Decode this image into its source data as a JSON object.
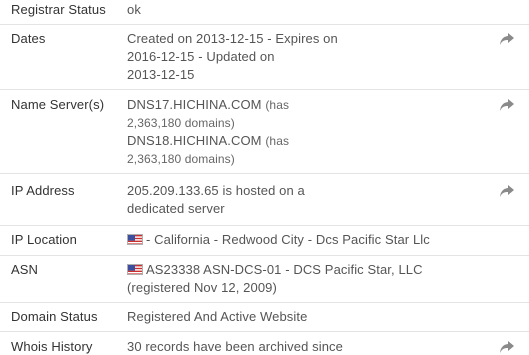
{
  "rows": {
    "registrar_status": {
      "label": "Registrar Status",
      "value": "ok"
    },
    "dates": {
      "label": "Dates",
      "lines": [
        "Created on 2013-12-15 - Expires on",
        "2016-12-15 - Updated on",
        "2013-12-15"
      ]
    },
    "name_servers": {
      "label": "Name Server(s)",
      "ns1": {
        "host": "DNS17.HICHINA.COM",
        "note1": "(has",
        "note2": "2,363,180 domains)"
      },
      "ns2": {
        "host": "DNS18.HICHINA.COM",
        "note1": "(has",
        "note2": "2,363,180 domains)"
      }
    },
    "ip_address": {
      "label": "IP Address",
      "lines": [
        "205.209.133.65 is hosted on a",
        "dedicated server"
      ]
    },
    "ip_location": {
      "label": "IP Location",
      "value": "- California - Redwood City - Dcs Pacific Star Llc"
    },
    "asn": {
      "label": "ASN",
      "line1": "AS23338 ASN-DCS-01 - DCS Pacific Star, LLC",
      "line2": "(registered Nov 12, 2009)"
    },
    "domain_status": {
      "label": "Domain Status",
      "value": "Registered And Active Website"
    },
    "whois_history": {
      "label": "Whois History",
      "value": "30 records have been archived since"
    }
  },
  "icons": {
    "share": "share-arrow-icon",
    "flag": "us-flag-icon"
  },
  "colors": {
    "label": "#333333",
    "value": "#555555",
    "divider": "#e3e3e3",
    "icon": "#8a8a8a"
  }
}
